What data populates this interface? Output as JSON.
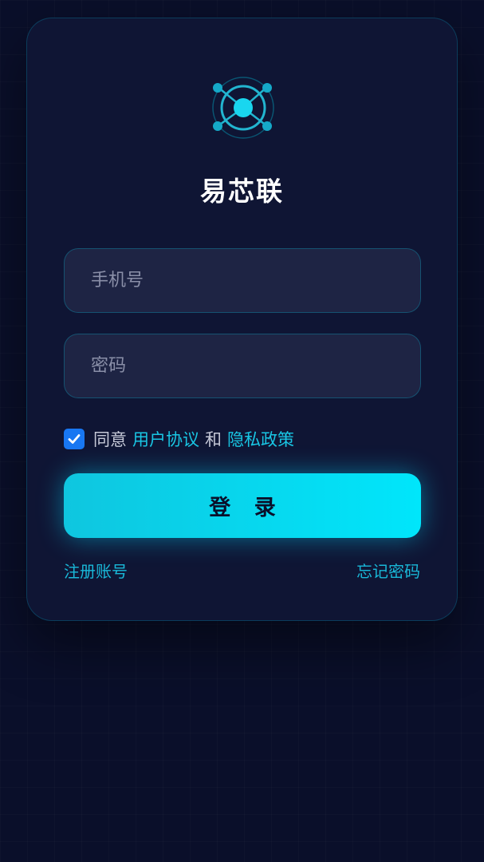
{
  "app": {
    "title": "易芯联"
  },
  "form": {
    "phone_placeholder": "手机号",
    "password_placeholder": "密码"
  },
  "agreement": {
    "checked": true,
    "prefix": "同意",
    "user_agreement": "用户协议",
    "conjunction": "和",
    "privacy_policy": "隐私政策"
  },
  "actions": {
    "login_label": "登 录",
    "register_label": "注册账号",
    "forgot_label": "忘记密码"
  },
  "colors": {
    "background": "#0a0f2a",
    "card": "#0f1534",
    "accent": "#00e6fb",
    "link": "#19c6e4",
    "checkbox": "#1877f2"
  },
  "icons": {
    "logo": "network-node-icon",
    "checkbox": "checkmark-icon"
  }
}
